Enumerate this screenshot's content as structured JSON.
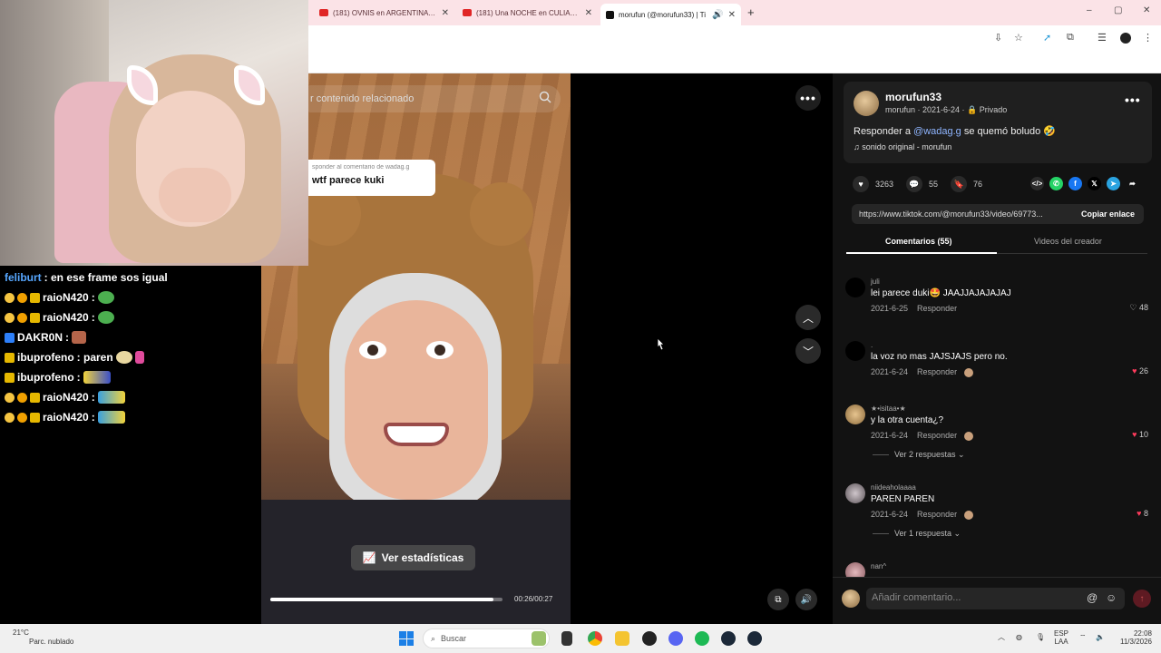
{
  "browser": {
    "tabs": [
      {
        "label": "(181) OVNIS en ARGENTINA - Y",
        "kind": "yt"
      },
      {
        "label": "(181) Una NOCHE en CULIACAN",
        "kind": "yt"
      },
      {
        "label": "morufun (@morufun33) | Ti",
        "kind": "tt",
        "active": true
      }
    ],
    "new_tab": "+",
    "window_controls": [
      "–",
      "▢",
      "✕"
    ]
  },
  "chat": {
    "messages": [
      {
        "user": "feliburt",
        "text": ": en ese frame sos igual"
      },
      {
        "user": "raioN420",
        "text": ":"
      },
      {
        "user": "raioN420",
        "text": ":"
      },
      {
        "user": "DAKR0N",
        "text": ":"
      },
      {
        "user": "ibuprofeno",
        "text": ": paren"
      },
      {
        "user": "ibuprofeno",
        "text": ":"
      },
      {
        "user": "raioN420",
        "text": ":"
      },
      {
        "user": "raioN420",
        "text": ":"
      }
    ]
  },
  "video": {
    "search_placeholder": "r contenido relacionado",
    "reply_small": "sponder al comentario de wadag.g",
    "reply_text": "wtf parece kuki",
    "stats_button": "Ver estadísticas",
    "time": "00:26/00:27",
    "progress": 0.96
  },
  "post": {
    "username": "morufun33",
    "sub": "morufun · 2021-6-24 · 🔒 Privado",
    "desc_prefix": "Responder a ",
    "desc_mention": "@wadag.g",
    "desc_suffix": " se quemó boludo 🤣",
    "sound": "♫  sonido original - morufun",
    "likes": "3263",
    "comments": "55",
    "saves": "76",
    "url": "https://www.tiktok.com/@morufun33/video/69773...",
    "copy_link": "Copiar enlace",
    "tab_comments": "Comentarios (55)",
    "tab_creator_videos": "Videos del creador"
  },
  "comments": [
    {
      "user": "juli",
      "text": "lei parece duki🤩 JAAJJAJAJAJAJ",
      "date": "2021-6-25",
      "reply": "Responder",
      "likes": "48",
      "liked": false,
      "creator_liked": false,
      "replies": ""
    },
    {
      "user": ".",
      "text": "la voz no mas JAJSJAJS pero no.",
      "date": "2021-6-24",
      "reply": "Responder",
      "likes": "26",
      "liked": true,
      "creator_liked": true,
      "replies": ""
    },
    {
      "user": "★•isitaa•★",
      "text": "y la otra cuenta¿?",
      "date": "2021-6-24",
      "reply": "Responder",
      "likes": "10",
      "liked": true,
      "creator_liked": true,
      "replies": "Ver 2 respuestas ⌄"
    },
    {
      "user": "niideaholaaaa",
      "text": "PAREN PAREN",
      "date": "2021-6-24",
      "reply": "Responder",
      "likes": "8",
      "liked": true,
      "creator_liked": true,
      "replies": "Ver 1 respuesta ⌄"
    },
    {
      "user": "nan^",
      "text": "",
      "date": "",
      "reply": "",
      "likes": "",
      "liked": false,
      "creator_liked": false,
      "replies": ""
    }
  ],
  "comment_input": {
    "placeholder": "Añadir comentario..."
  },
  "taskbar": {
    "temp": "21°C",
    "weather": "Parc. nublado",
    "search": "Buscar",
    "lang": "ESP",
    "lang2": "LAA",
    "time": "22:08",
    "date": "11/3/2026"
  },
  "colors": {
    "accent": "#ff3b5c",
    "link": "#8fb5ff",
    "chat_blue": "#57a7ff"
  }
}
